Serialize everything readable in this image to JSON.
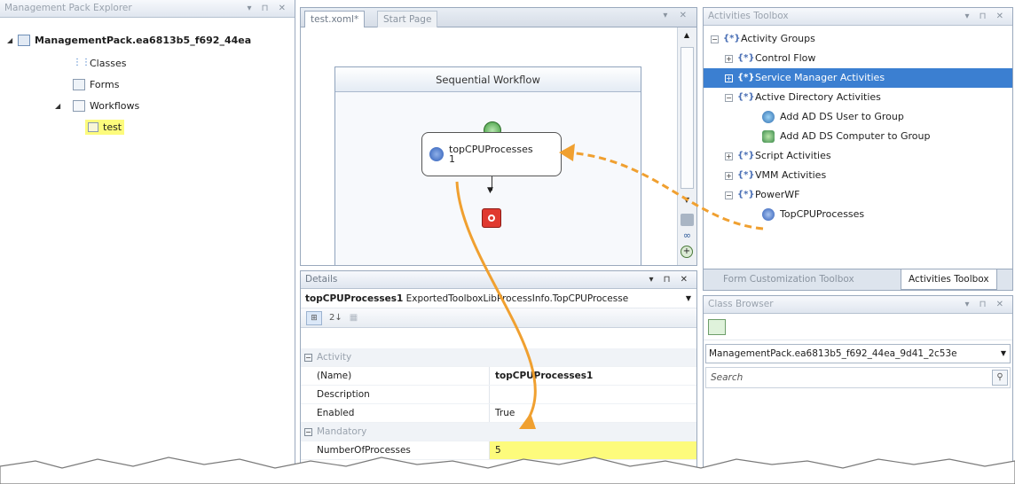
{
  "explorer": {
    "title": "Management Pack Explorer",
    "controls": "▾ ⊓ ✕",
    "root_label": "ManagementPack.ea6813b5_f692_44ea",
    "items": [
      {
        "label": "Classes"
      },
      {
        "label": "Forms"
      },
      {
        "label": "Workflows"
      }
    ],
    "workflow_child": "test"
  },
  "designer": {
    "tabs": [
      {
        "label": "test.xoml*"
      },
      {
        "label": "Start Page"
      }
    ],
    "controls": "▾ ✕",
    "workflow_title": "Sequential Workflow",
    "activity_label": "topCPUProcesses\n1"
  },
  "details": {
    "title": "Details",
    "controls": "▾ ⊓ ✕",
    "object_name": "topCPUProcesses1",
    "object_type": "ExportedToolboxLibProcessInfo.TopCPUProcesse",
    "toolbar": [
      "⊞",
      "2↓",
      "▦"
    ],
    "categories": [
      {
        "name": "Activity",
        "rows": [
          {
            "key": "(Name)",
            "value": "topCPUProcesses1"
          },
          {
            "key": "Description",
            "value": ""
          },
          {
            "key": "Enabled",
            "value": "True"
          }
        ]
      },
      {
        "name": "Mandatory",
        "rows": [
          {
            "key": "NumberOfProcesses",
            "value": "5"
          }
        ]
      }
    ]
  },
  "toolbox": {
    "title": "Activities Toolbox",
    "controls": "▾ ⊓ ✕",
    "items": [
      {
        "label": "Activity Groups"
      },
      {
        "label": "Control Flow"
      },
      {
        "label": "Service Manager Activities"
      },
      {
        "label": "Active Directory Activities"
      },
      {
        "label": "Add AD DS User to Group"
      },
      {
        "label": "Add AD DS Computer to Group"
      },
      {
        "label": "Script Activities"
      },
      {
        "label": "VMM Activities"
      },
      {
        "label": "PowerWF"
      },
      {
        "label": "TopCPUProcesses"
      }
    ],
    "bottom_tabs": [
      {
        "label": "Form Customization Toolbox"
      },
      {
        "label": "Activities Toolbox"
      }
    ]
  },
  "class_browser": {
    "title": "Class Browser",
    "controls": "▾ ⊓ ✕",
    "combo_value": "ManagementPack.ea6813b5_f692_44ea_9d41_2c53e",
    "search_placeholder": "Search"
  },
  "colors": {
    "highlight_yellow": "#fdfb7c",
    "selection_blue": "#3b7fd1",
    "arrow_orange": "#f0a030"
  }
}
